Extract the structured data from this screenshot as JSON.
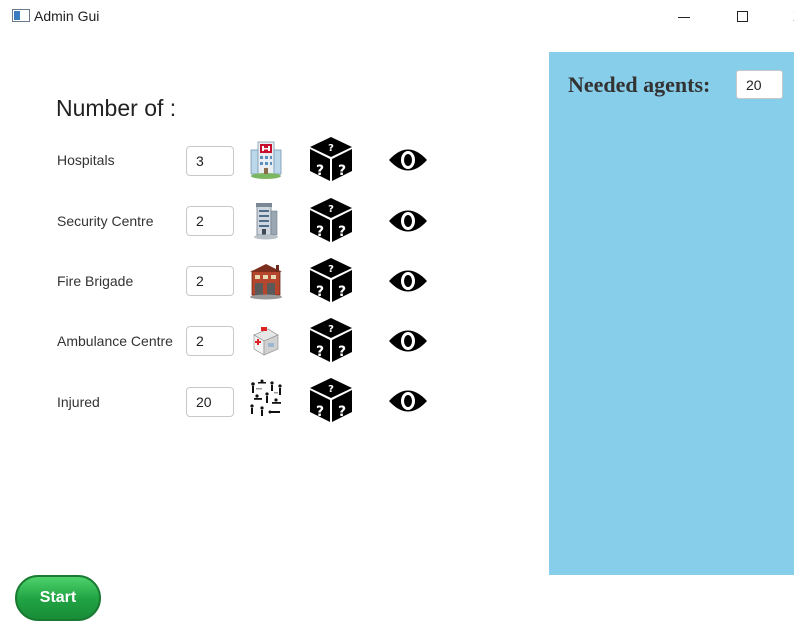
{
  "window": {
    "title": "Admin Gui",
    "close_glyph": "X"
  },
  "form": {
    "heading": "Number of :",
    "rows": [
      {
        "label": "Hospitals",
        "value": "3",
        "icon": "hospital-icon"
      },
      {
        "label": "Security Centre",
        "value": "2",
        "icon": "security-centre-icon"
      },
      {
        "label": "Fire Brigade",
        "value": "2",
        "icon": "fire-brigade-icon"
      },
      {
        "label": "Ambulance Centre",
        "value": "2",
        "icon": "ambulance-centre-icon"
      },
      {
        "label": "Injured",
        "value": "20",
        "icon": "injured-icon"
      }
    ]
  },
  "panel": {
    "agents_label": "Needed agents:",
    "agents_value": "20",
    "background": "#87ceeb"
  },
  "actions": {
    "start_label": "Start",
    "start_color": "#22a544"
  }
}
